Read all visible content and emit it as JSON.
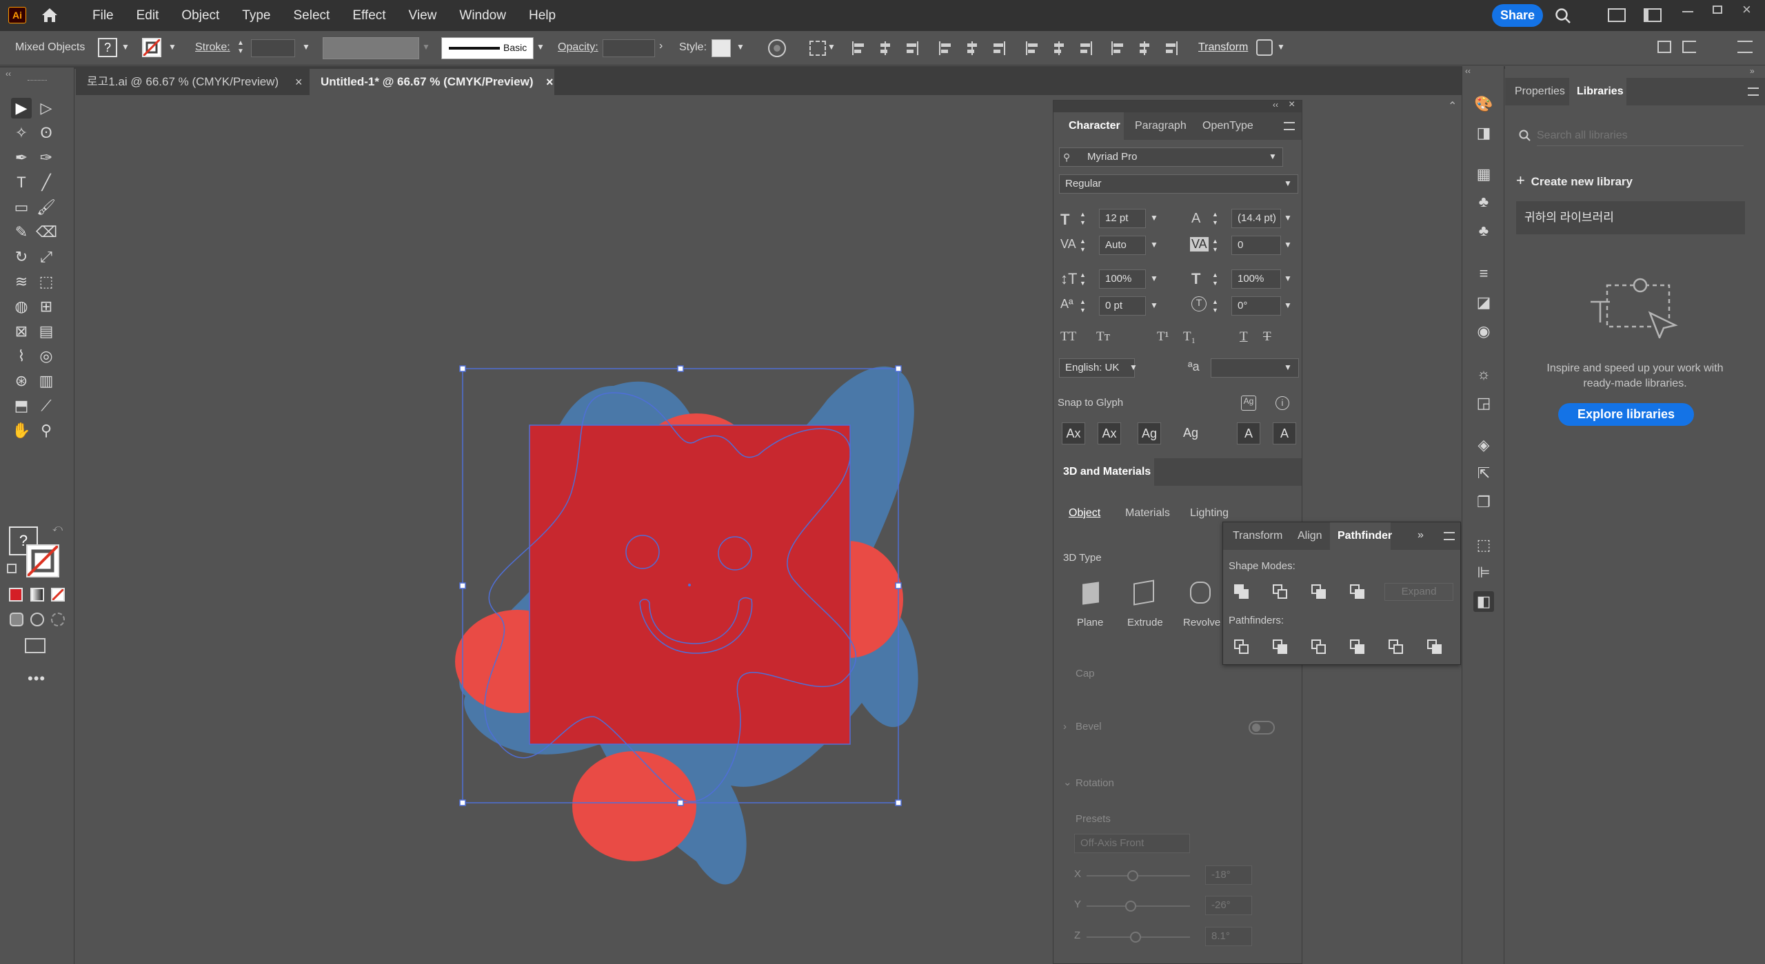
{
  "menubar": {
    "app_logo": "Ai",
    "items": [
      "File",
      "Edit",
      "Object",
      "Type",
      "Select",
      "Effect",
      "View",
      "Window",
      "Help"
    ],
    "share_label": "Share"
  },
  "controlbar": {
    "selection_label": "Mixed Objects",
    "fill_unknown": "?",
    "stroke_label": "Stroke:",
    "brush_label": "Basic",
    "opacity_label": "Opacity:",
    "style_label": "Style:",
    "transform_label": "Transform"
  },
  "tabs": [
    {
      "label": "로고1.ai @ 66.67 % (CMYK/Preview)",
      "active": false
    },
    {
      "label": "Untitled-1* @ 66.67 % (CMYK/Preview)",
      "active": true
    }
  ],
  "character_panel": {
    "tabs": [
      "Character",
      "Paragraph",
      "OpenType"
    ],
    "font_family": "Myriad Pro",
    "font_style": "Regular",
    "font_size": "12 pt",
    "leading": "(14.4 pt)",
    "kerning": "Auto",
    "tracking": "0",
    "vertical_scale": "100%",
    "horizontal_scale": "100%",
    "baseline_shift": "0 pt",
    "rotation": "0°",
    "language": "English: UK",
    "snap_to_glyph": "Snap to Glyph"
  },
  "materials_panel": {
    "title": "3D and Materials",
    "tabs": [
      "Object",
      "Materials",
      "Lighting"
    ],
    "type_label": "3D Type",
    "types": [
      "Plane",
      "Extrude",
      "Revolve"
    ],
    "cap_label": "Cap",
    "bevel_label": "Bevel",
    "rotation_label": "Rotation",
    "presets_label": "Presets",
    "preset_value": "Off-Axis Front",
    "x_label": "X",
    "x_value": "-18°",
    "y_label": "Y",
    "y_value": "-26°",
    "z_label": "Z",
    "z_value": "8.1°"
  },
  "pathfinder_panel": {
    "tabs": [
      "Transform",
      "Align",
      "Pathfinder"
    ],
    "shape_modes_label": "Shape Modes:",
    "expand_label": "Expand",
    "pathfinders_label": "Pathfinders:"
  },
  "libraries_panel": {
    "tabs": [
      "Properties",
      "Libraries"
    ],
    "search_placeholder": "Search all libraries",
    "create_label": "Create new library",
    "library_name": "귀하의 라이브러리",
    "empty_text_line1": "Inspire and speed up your work with",
    "empty_text_line2": "ready-made libraries.",
    "explore_label": "Explore libraries"
  },
  "colors": {
    "accent": "#1473e6",
    "artwork_red": "#c8282f",
    "artwork_blue": "#4a78a8",
    "artwork_orange": "#e94b45",
    "selection": "#4f6fd8"
  }
}
